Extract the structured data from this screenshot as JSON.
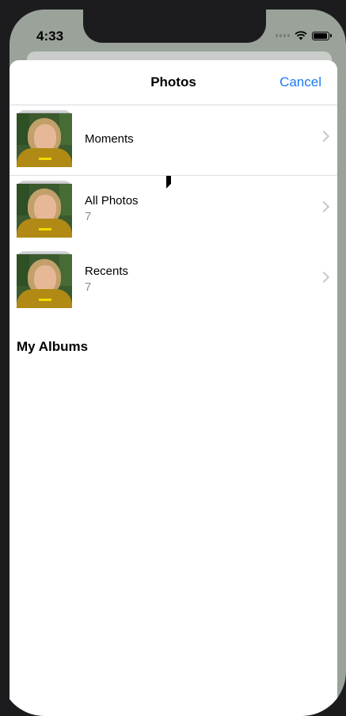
{
  "status": {
    "time": "4:33"
  },
  "header": {
    "title": "Photos",
    "cancel_label": "Cancel"
  },
  "rows": [
    {
      "label": "Moments",
      "count": ""
    },
    {
      "label": "All Photos",
      "count": "7"
    },
    {
      "label": "Recents",
      "count": "7"
    }
  ],
  "section": {
    "my_albums_label": "My Albums"
  },
  "colors": {
    "accent": "#1a7bf6",
    "secondary_text": "#8e8e93",
    "separator": "#e1e1e4"
  },
  "icons": [
    "wifi-icon",
    "battery-icon",
    "cellular-signal-icon",
    "chevron-right-icon",
    "mouse-cursor-icon"
  ]
}
